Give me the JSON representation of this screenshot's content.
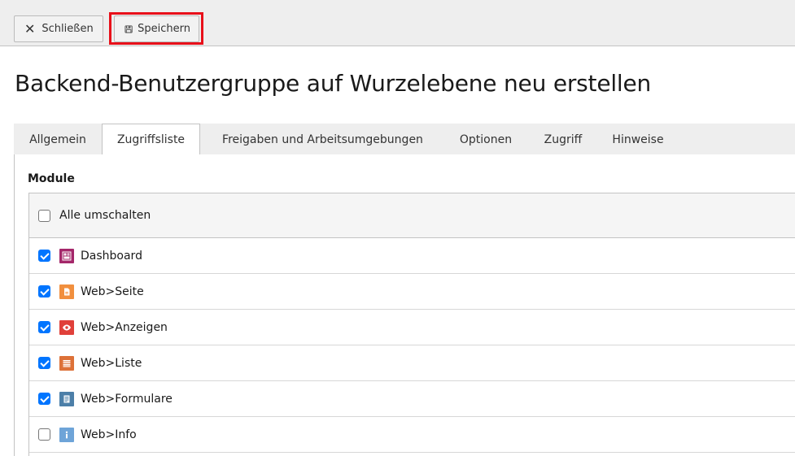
{
  "toolbar": {
    "close_label": "Schließen",
    "save_label": "Speichern"
  },
  "page": {
    "title": "Backend-Benutzergruppe auf Wurzelebene neu erstellen"
  },
  "tabs": [
    {
      "label": "Allgemein",
      "active": false
    },
    {
      "label": "Zugriffsliste",
      "active": true
    },
    {
      "label": "Freigaben und Arbeitsumgebungen",
      "active": false
    },
    {
      "label": "Optionen",
      "active": false
    },
    {
      "label": "Zugriff",
      "active": false
    },
    {
      "label": "Hinweise",
      "active": false
    }
  ],
  "modules": {
    "section_label": "Module",
    "toggle_all_label": "Alle umschalten",
    "items": [
      {
        "label": "Dashboard",
        "checked": true,
        "icon": "dashboard-icon",
        "color": "#a4276a"
      },
      {
        "label": "Web>Seite",
        "checked": true,
        "icon": "page-icon",
        "color": "#f18f3e"
      },
      {
        "label": "Web>Anzeigen",
        "checked": true,
        "icon": "eye-icon",
        "color": "#e0403a"
      },
      {
        "label": "Web>Liste",
        "checked": true,
        "icon": "list-icon",
        "color": "#dd7138"
      },
      {
        "label": "Web>Formulare",
        "checked": true,
        "icon": "form-icon",
        "color": "#4c7fa8"
      },
      {
        "label": "Web>Info",
        "checked": false,
        "icon": "info-icon",
        "color": "#6ea4d8"
      }
    ]
  }
}
